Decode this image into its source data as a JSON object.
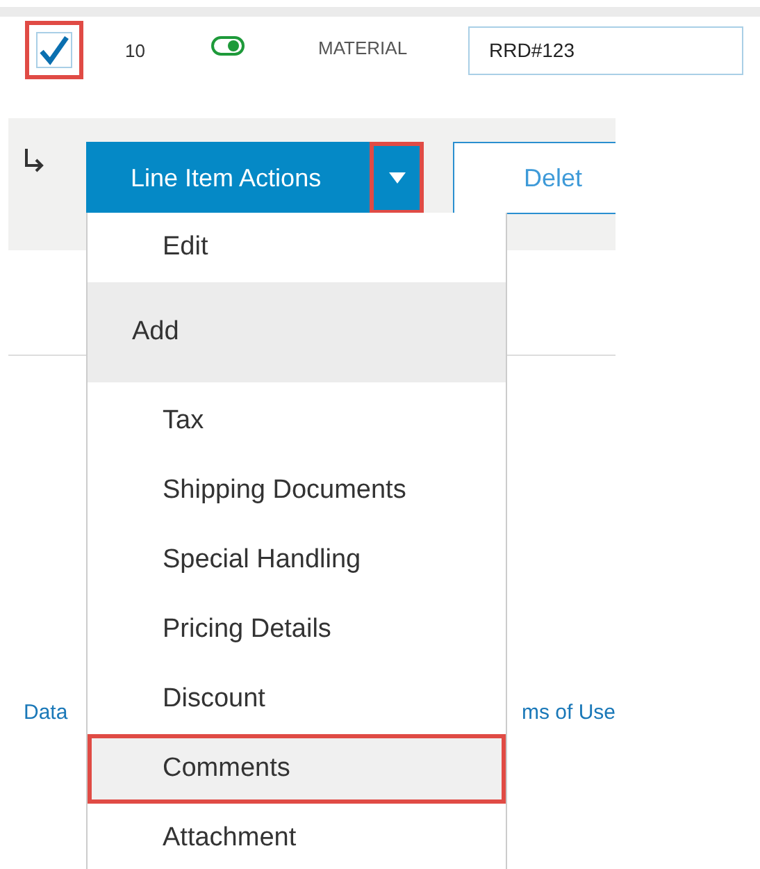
{
  "row": {
    "checked": true,
    "checkbox_annotated": true,
    "line_number": "10",
    "active": true,
    "type": "MATERIAL",
    "reference": "RRD#123"
  },
  "actions": {
    "button": "Line Item Actions",
    "caret_annotated": true,
    "delete": "Delet"
  },
  "footer": {
    "left_link": "Data",
    "right_link": "ms of Use"
  },
  "menu": [
    {
      "kind": "item",
      "label": "Edit",
      "selected": false,
      "annotated": false
    },
    {
      "kind": "header",
      "label": "Add"
    },
    {
      "kind": "item",
      "label": "Tax",
      "selected": false,
      "annotated": false
    },
    {
      "kind": "item",
      "label": "Shipping Documents",
      "selected": false,
      "annotated": false
    },
    {
      "kind": "item",
      "label": "Special Handling",
      "selected": false,
      "annotated": false
    },
    {
      "kind": "item",
      "label": "Pricing Details",
      "selected": false,
      "annotated": false
    },
    {
      "kind": "item",
      "label": "Discount",
      "selected": false,
      "annotated": false
    },
    {
      "kind": "item",
      "label": "Comments",
      "selected": true,
      "annotated": true
    },
    {
      "kind": "item",
      "label": "Attachment",
      "selected": false,
      "annotated": false
    }
  ]
}
